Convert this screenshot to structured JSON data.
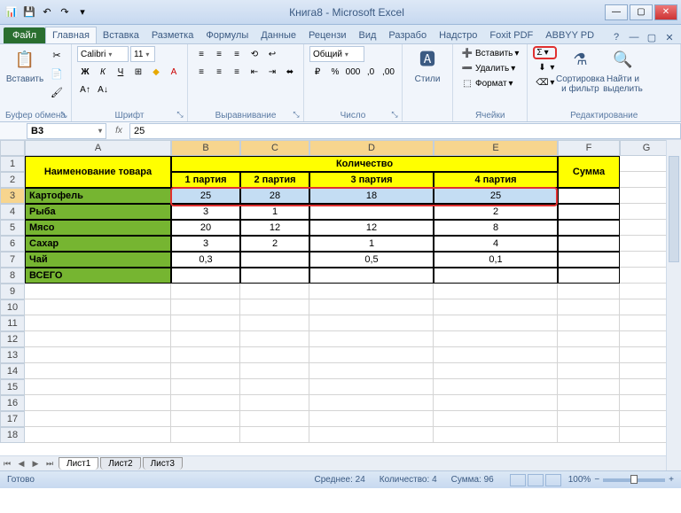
{
  "title": "Книга8 - Microsoft Excel",
  "tabs": {
    "file": "Файл",
    "home": "Главная",
    "insert": "Вставка",
    "layout": "Разметка",
    "formulas": "Формулы",
    "data": "Данные",
    "review": "Рецензи",
    "view": "Вид",
    "developer": "Разрабо",
    "addins": "Надстро",
    "foxit": "Foxit PDF",
    "abbyy": "ABBYY PD"
  },
  "ribbon": {
    "clipboard": {
      "paste": "Вставить",
      "label": "Буфер обмена"
    },
    "font": {
      "name": "Calibri",
      "size": "11",
      "label": "Шрифт"
    },
    "alignment": {
      "label": "Выравнивание"
    },
    "number": {
      "format": "Общий",
      "label": "Число"
    },
    "styles": {
      "btn": "Стили",
      "label": ""
    },
    "cells": {
      "insert": "Вставить",
      "delete": "Удалить",
      "format": "Формат",
      "label": "Ячейки"
    },
    "editing": {
      "sigma": "Σ",
      "sort": "Сортировка и фильтр",
      "find": "Найти и выделить",
      "label": "Редактирование"
    }
  },
  "namebox": "B3",
  "formula": "25",
  "columns": [
    "A",
    "B",
    "C",
    "D",
    "E",
    "F",
    "G"
  ],
  "rows": [
    "1",
    "2",
    "3",
    "4",
    "5",
    "6",
    "7",
    "8",
    "9",
    "10",
    "11",
    "12",
    "13",
    "14",
    "15",
    "16",
    "17",
    "18"
  ],
  "table": {
    "hdr_name": "Наименование товара",
    "hdr_qty": "Количество",
    "hdr_batch": [
      "1 партия",
      "2 партия",
      "3 партия",
      "4 партия"
    ],
    "hdr_sum": "Сумма",
    "items": [
      "Картофель",
      "Рыба",
      "Мясо",
      "Сахар",
      "Чай",
      "ВСЕГО"
    ],
    "data": [
      [
        "25",
        "28",
        "18",
        "25"
      ],
      [
        "3",
        "1",
        "",
        "2"
      ],
      [
        "20",
        "12",
        "12",
        "8"
      ],
      [
        "3",
        "2",
        "1",
        "4"
      ],
      [
        "0,3",
        "",
        "0,5",
        "0,1"
      ],
      [
        "",
        "",
        "",
        ""
      ]
    ]
  },
  "sheets": [
    "Лист1",
    "Лист2",
    "Лист3"
  ],
  "status": {
    "ready": "Готово",
    "avg_label": "Среднее:",
    "avg": "24",
    "count_label": "Количество:",
    "count": "4",
    "sum_label": "Сумма:",
    "sum": "96",
    "zoom": "100%"
  },
  "chart_data": {
    "type": "table",
    "title": "Количество",
    "columns": [
      "Наименование товара",
      "1 партия",
      "2 партия",
      "3 партия",
      "4 партия",
      "Сумма"
    ],
    "rows": [
      {
        "name": "Картофель",
        "values": [
          25,
          28,
          18,
          25
        ]
      },
      {
        "name": "Рыба",
        "values": [
          3,
          1,
          null,
          2
        ]
      },
      {
        "name": "Мясо",
        "values": [
          20,
          12,
          12,
          8
        ]
      },
      {
        "name": "Сахар",
        "values": [
          3,
          2,
          1,
          4
        ]
      },
      {
        "name": "Чай",
        "values": [
          0.3,
          null,
          0.5,
          0.1
        ]
      },
      {
        "name": "ВСЕГО",
        "values": [
          null,
          null,
          null,
          null
        ]
      }
    ]
  }
}
